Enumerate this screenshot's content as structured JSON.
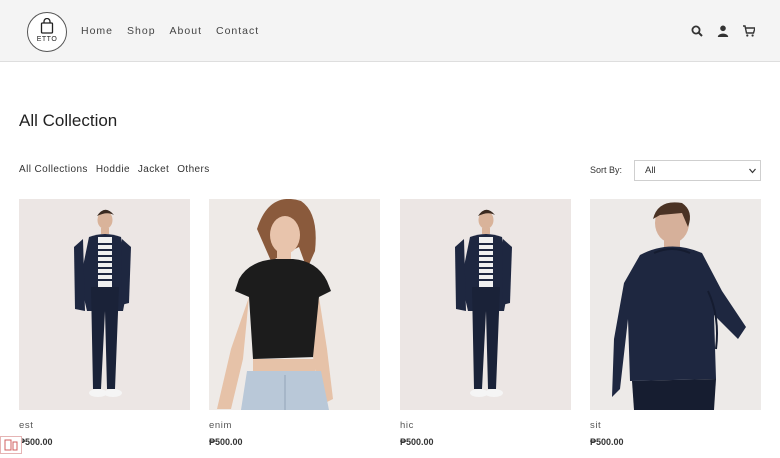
{
  "header": {
    "logo_text": "ETTO",
    "nav": [
      "Home",
      "Shop",
      "About",
      "Contact"
    ],
    "icons": [
      "search-icon",
      "user-icon",
      "cart-icon"
    ]
  },
  "page": {
    "title": "All Collection",
    "filters": [
      "All Collections",
      "Hoddie",
      "Jacket",
      "Others"
    ],
    "sort_label": "Sort By:",
    "sort_value": "All"
  },
  "products": [
    {
      "name": "est",
      "price": "₱500.00"
    },
    {
      "name": "enim",
      "price": "₱500.00"
    },
    {
      "name": "hic",
      "price": "₱500.00"
    },
    {
      "name": "sit",
      "price": "₱500.00"
    }
  ],
  "colors": {
    "header_bg": "#f4f4f4",
    "image_bg": "#ece6e4",
    "navy": "#1e2740"
  }
}
